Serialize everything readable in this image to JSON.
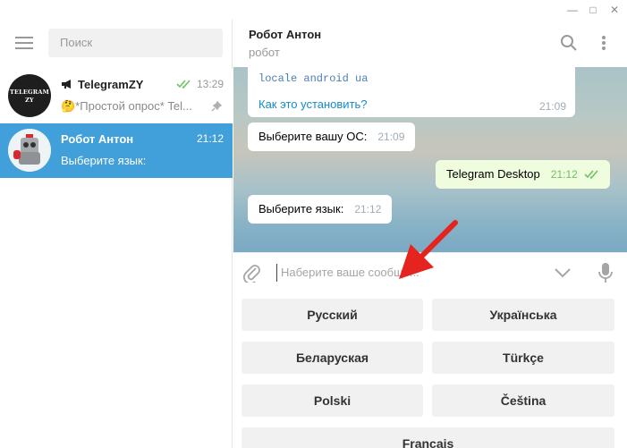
{
  "search": {
    "placeholder": "Поиск"
  },
  "chats": [
    {
      "name": "TelegramZY",
      "time": "13:29",
      "last": "🤔*Простой опрос* Tel...",
      "avatar_text_1": "TELEGRAM",
      "avatar_text_2": "ZY"
    },
    {
      "name": "Робот Антон",
      "time": "21:12",
      "last": "Выберите язык:"
    }
  ],
  "header": {
    "name": "Робот Антон",
    "status": "робот"
  },
  "messages": {
    "m1": {
      "code": "locale android ua",
      "link": "Как это установить?",
      "time": "21:09"
    },
    "m2": {
      "text": "Выберите вашу ОС:",
      "time": "21:09"
    },
    "m3": {
      "text": "Telegram Desktop",
      "time": "21:12"
    },
    "m4": {
      "text": "Выберите язык:",
      "time": "21:12"
    }
  },
  "composer": {
    "placeholder": "Наберите ваше сообще..."
  },
  "keyboard": {
    "b1": "Русский",
    "b2": "Українська",
    "b3": "Беларуская",
    "b4": "Türkçe",
    "b5": "Polski",
    "b6": "Čeština",
    "b7": "Français"
  },
  "icons": [
    "menu-icon",
    "megaphone-icon",
    "double-check-icon",
    "pin-icon",
    "search-icon",
    "more-icon",
    "paperclip-icon",
    "chevron-down-icon",
    "microphone-icon",
    "red-arrow"
  ],
  "colors": {
    "accent": "#419fd9",
    "arrow": "#e5231f",
    "out_check": "#6cc264"
  }
}
